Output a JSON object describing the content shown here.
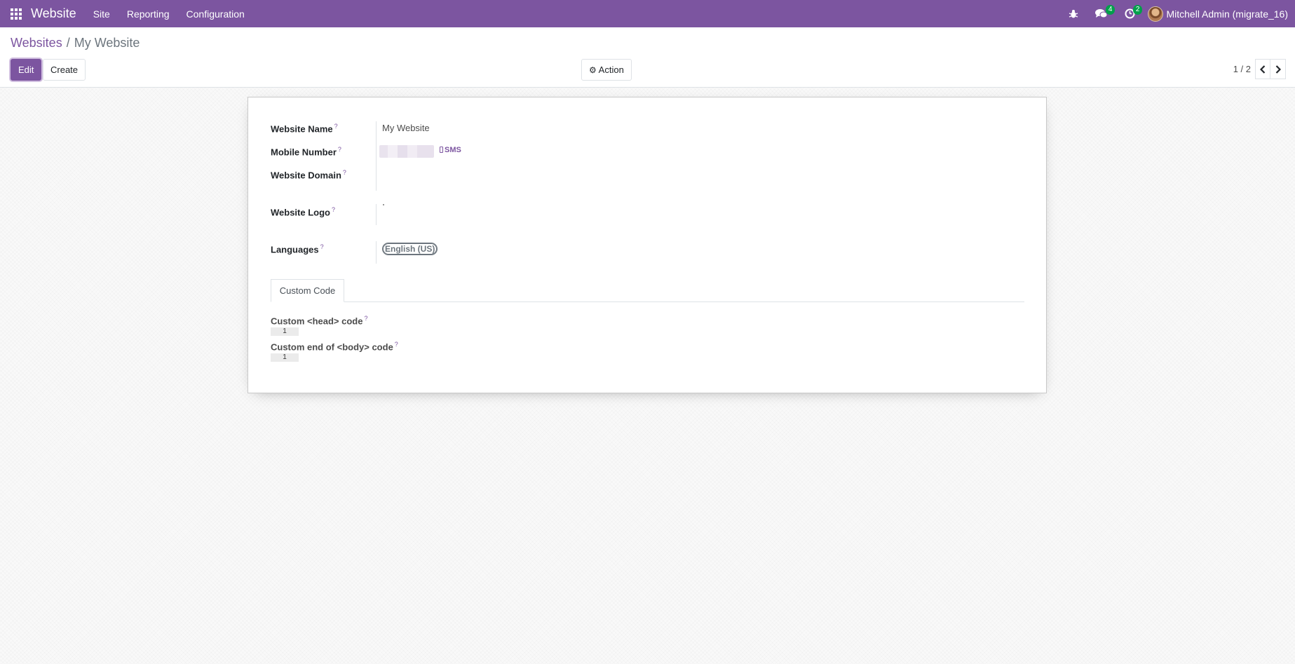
{
  "navbar": {
    "app_name": "Website",
    "menu": [
      "Site",
      "Reporting",
      "Configuration"
    ],
    "messages_count": "4",
    "activities_count": "2",
    "user_name": "Mitchell Admin (migrate_16)",
    "colors": {
      "brand": "#7c55a0",
      "badge": "#00a04a"
    }
  },
  "control_panel": {
    "breadcrumb_parent": "Websites",
    "breadcrumb_separator": "/",
    "breadcrumb_current": "My Website",
    "edit_label": "Edit",
    "create_label": "Create",
    "action_label": "Action",
    "pager_value": "1 / 2"
  },
  "form": {
    "website_name_label": "Website Name",
    "website_name_value": "My Website",
    "mobile_number_label": "Mobile Number",
    "sms_label": "SMS",
    "website_domain_label": "Website Domain",
    "website_logo_label": "Website Logo",
    "languages_label": "Languages",
    "language_tag": "English (US)",
    "help_mark": "?"
  },
  "tabs": {
    "custom_code_label": "Custom Code"
  },
  "custom_code": {
    "head_label": "Custom <head> code",
    "head_line": "1",
    "body_label": "Custom end of <body> code",
    "body_line": "1"
  }
}
